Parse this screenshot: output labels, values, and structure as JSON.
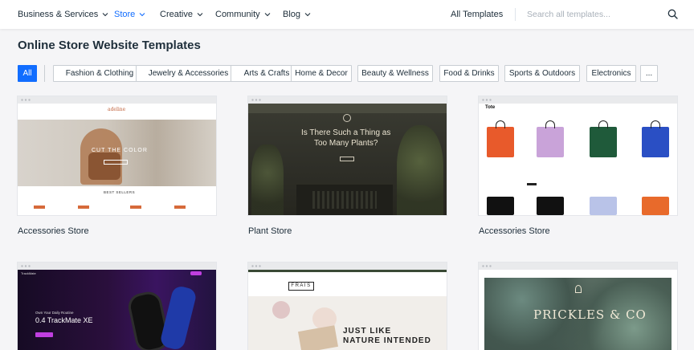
{
  "nav": {
    "items": [
      {
        "label": "Business & Services",
        "active": false
      },
      {
        "label": "Store",
        "active": true
      },
      {
        "label": "Creative",
        "active": false
      },
      {
        "label": "Community",
        "active": false
      },
      {
        "label": "Blog",
        "active": false
      }
    ],
    "all_templates": "All Templates",
    "search_placeholder": "Search all templates..."
  },
  "page_title": "Online Store Website Templates",
  "filters": [
    "All",
    "Fashion & Clothing",
    "Jewelry & Accessories",
    "Arts & Crafts",
    "Home & Decor",
    "Beauty & Wellness",
    "Food & Drinks",
    "Sports & Outdoors",
    "Electronics",
    "..."
  ],
  "templates": [
    {
      "name": "Accessories Store",
      "preview_brand": "adeline",
      "preview_headline": "CUT THE COLOR",
      "preview_section": "BEST SELLERS"
    },
    {
      "name": "Plant Store",
      "preview_headline_1": "Is There Such a Thing as",
      "preview_headline_2": "Too Many Plants?"
    },
    {
      "name": "Accessories Store",
      "preview_brand": "Tote"
    },
    {
      "name": "",
      "preview_brand": "TrackMate",
      "preview_headline": "0.4 TrackMate XE",
      "preview_sub": "Own Your Daily Routine"
    },
    {
      "name": "",
      "preview_brand": "FRAIS",
      "preview_headline_1": "JUST LIKE",
      "preview_headline_2": "NATURE INTENDED"
    },
    {
      "name": "",
      "preview_brand": "PRICKLES & CO"
    }
  ],
  "colors": {
    "accent": "#116dff",
    "text": "#20303c",
    "background": "#f5f5f7"
  }
}
